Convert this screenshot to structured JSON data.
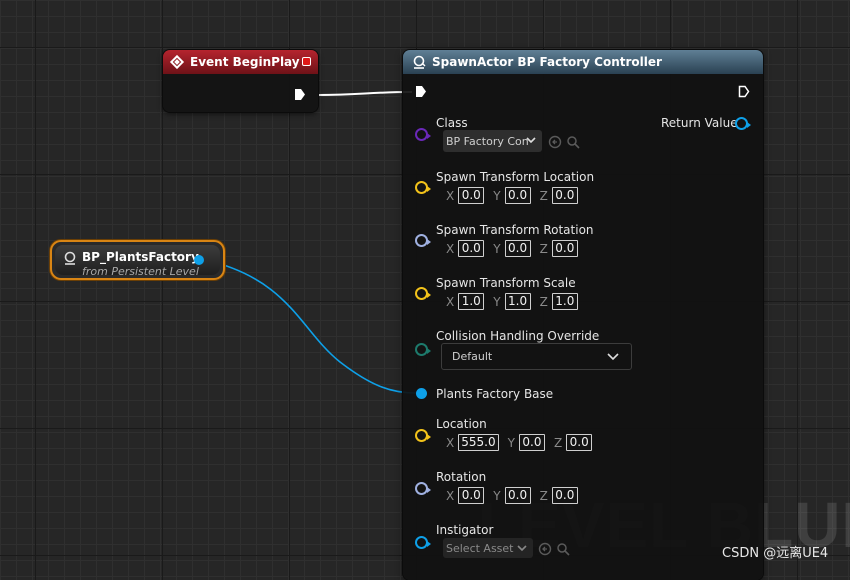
{
  "watermark": "LEVEL BLUEPR",
  "credit": "CSDN @远离UE4",
  "colors": {
    "exec": "#ffffff",
    "object": "#0ea0e8",
    "class": "#6a28b8",
    "vector": "#f2c21a",
    "rotator": "#9fb0e0",
    "enum": "#1d7a6c",
    "event_header": "#b5242e",
    "spawn_header": "#5f7f95",
    "variable_border": "#d98514"
  },
  "event_node": {
    "title": "Event BeginPlay",
    "icon": "event-diamond-icon"
  },
  "variable_node": {
    "title": "BP_PlantsFactory",
    "subtitle": "from Persistent Level",
    "icon": "actor-icon"
  },
  "spawn_node": {
    "title": "SpawnActor BP Factory Controller",
    "icon": "spawn-icon",
    "class": {
      "label": "Class",
      "value": "BP Factory Con"
    },
    "return_value": "Return Value",
    "spawn_location": {
      "label": "Spawn Transform Location",
      "x": "0.0",
      "y": "0.0",
      "z": "0.0"
    },
    "spawn_rotation": {
      "label": "Spawn Transform Rotation",
      "x": "0.0",
      "y": "0.0",
      "z": "0.0"
    },
    "spawn_scale": {
      "label": "Spawn Transform Scale",
      "x": "1.0",
      "y": "1.0",
      "z": "1.0"
    },
    "collision": {
      "label": "Collision Handling Override",
      "value": "Default"
    },
    "plants_factory": {
      "label": "Plants Factory Base"
    },
    "location": {
      "label": "Location",
      "x": "555.0",
      "y": "0.0",
      "z": "0.0"
    },
    "rotation": {
      "label": "Rotation",
      "x": "0.0",
      "y": "0.0",
      "z": "0.0"
    },
    "instigator": {
      "label": "Instigator",
      "value": "Select Asset"
    },
    "axis_labels": {
      "x": "X",
      "y": "Y",
      "z": "Z"
    }
  }
}
